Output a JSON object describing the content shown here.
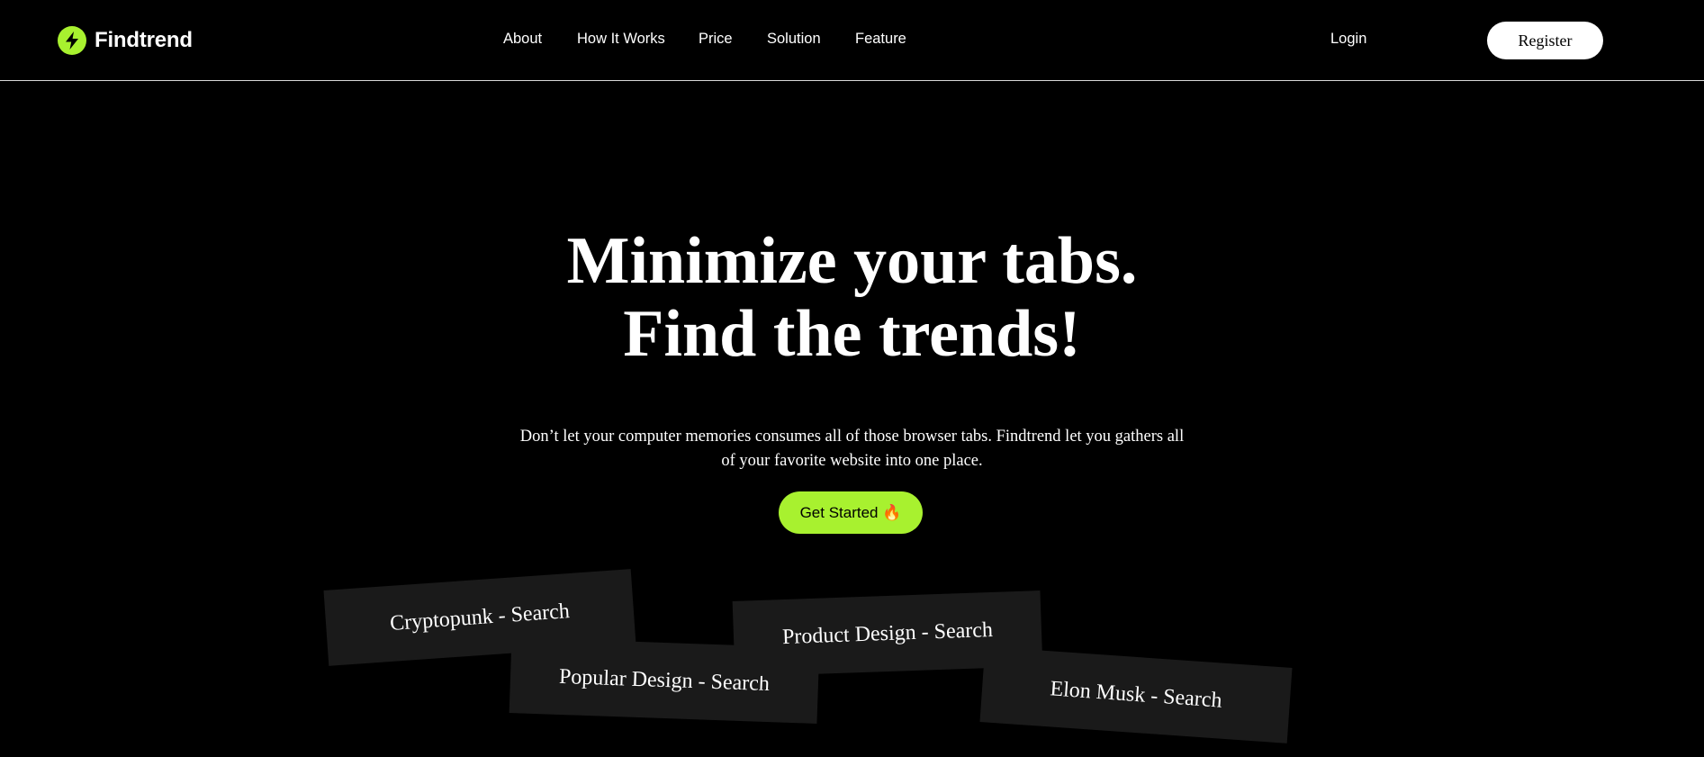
{
  "brand": {
    "name": "Findtrend",
    "logo_icon": "lightning-bolt-icon",
    "accent_color": "#a8f12f"
  },
  "nav": {
    "links": [
      "About",
      "How It Works",
      "Price",
      "Solution",
      "Feature"
    ],
    "login_label": "Login",
    "register_label": "Register"
  },
  "hero": {
    "heading_line1": "Minimize your tabs.",
    "heading_line2": "Find the trends!",
    "subtitle": "Don’t let your computer memories consumes all of those browser tabs. Findtrend let you gathers all of your favorite website into one place.",
    "cta_label": "Get Started 🔥"
  },
  "tabs": [
    "Cryptopunk - Search",
    "Popular Design - Search",
    "Product Design - Search",
    "Elon Musk - Search"
  ]
}
